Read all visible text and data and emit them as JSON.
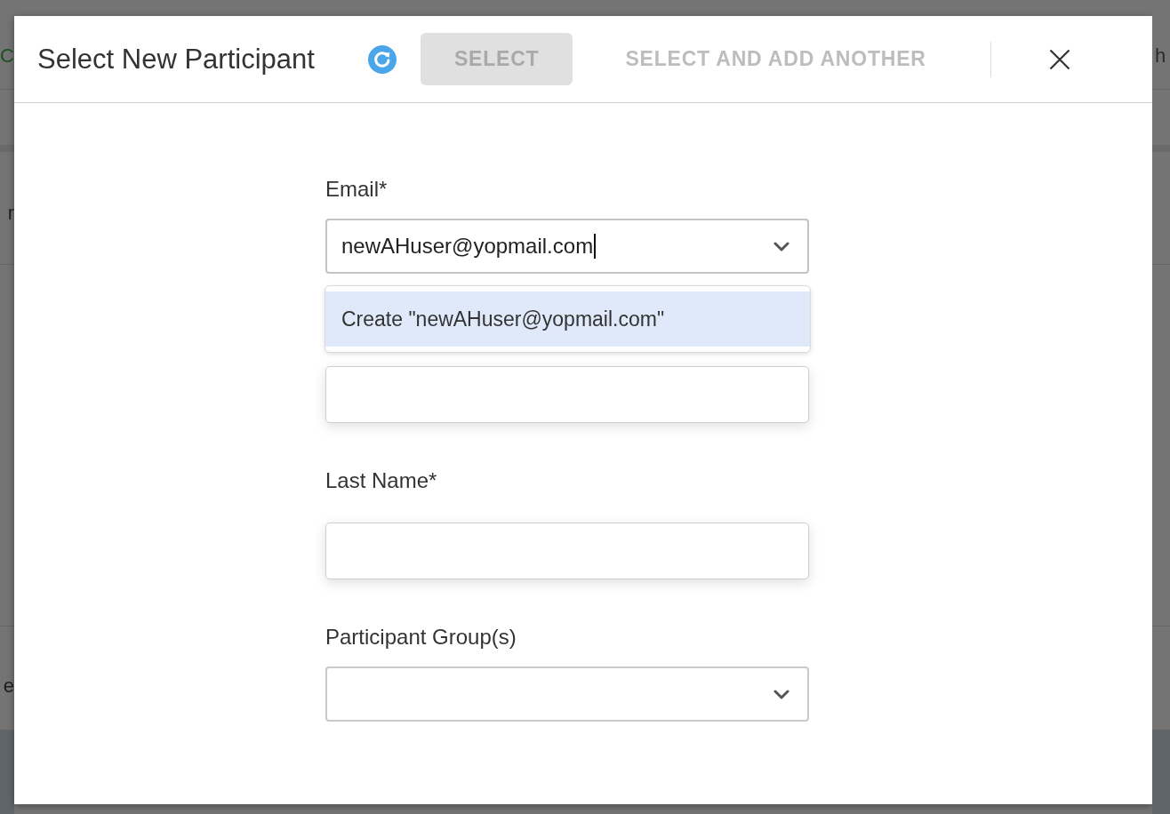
{
  "background_page": {
    "left_edge_texts": [
      {
        "text": "C",
        "color": "#1d521d"
      },
      {
        "text": "r",
        "color": "#222222"
      },
      {
        "text": "e",
        "color": "#1e1e1e"
      }
    ],
    "right_edge_texts": [
      {
        "text": "h",
        "color": "#2a2a2a"
      }
    ]
  },
  "dialog": {
    "title": "Select New Participant",
    "loading": true,
    "buttons": [
      {
        "label": "SELECT",
        "kind": "filled",
        "disabled": true
      },
      {
        "label": "SELECT AND ADD ANOTHER",
        "kind": "text",
        "disabled": true
      }
    ],
    "fields": [
      {
        "kind": "combobox",
        "label": "Email*",
        "value": "newAHuser@yopmail.com",
        "focused": true,
        "options": [
          {
            "label": "Create \"newAHuser@yopmail.com\"",
            "selected": true
          }
        ]
      },
      {
        "kind": "text",
        "focused": false
      },
      {
        "kind": "text",
        "label": "Last Name*",
        "focused": false
      },
      {
        "kind": "select",
        "label": "Participant Group(s)",
        "focused": false
      }
    ]
  }
}
